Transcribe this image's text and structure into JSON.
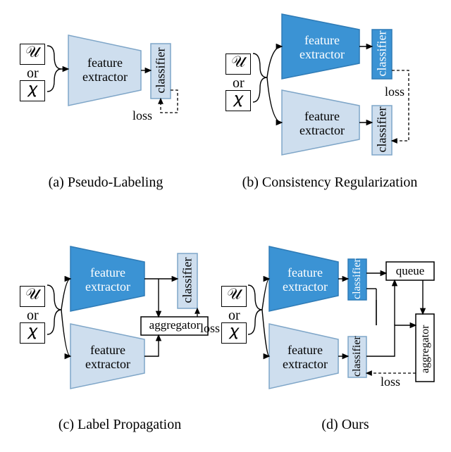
{
  "labels": {
    "u": "𝒰",
    "chi": "𝜒",
    "or": "or",
    "feature_extractor": "feature\nextractor",
    "classifier": "classifier",
    "aggregator": "aggregator",
    "queue": "queue",
    "loss": "loss"
  },
  "captions": {
    "a": "(a) Pseudo-Labeling",
    "b": "(b) Consistency Regularization",
    "c": "(c) Label  Propagation",
    "d": "(d) Ours"
  },
  "colors": {
    "dark_fill": "#3b93d4",
    "dark_stroke": "#2f7bb6",
    "light_fill": "#cedeee",
    "light_stroke": "#7fa6c8"
  }
}
